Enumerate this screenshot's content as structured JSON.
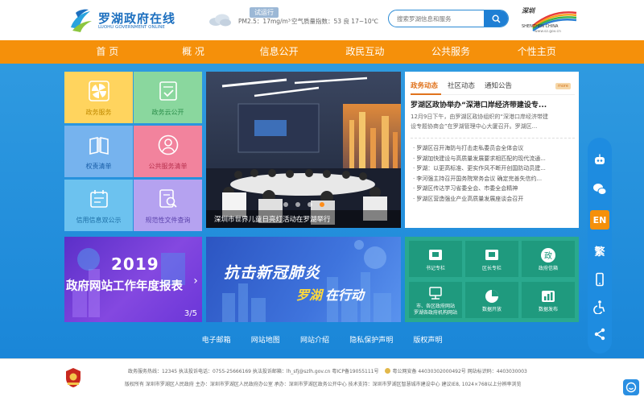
{
  "header": {
    "site_title": "罗湖政府在线",
    "site_subtitle": "LUOHU GOVERNMENT ONLINE",
    "trial_badge": "试运行",
    "weather": {
      "pm25": "PM2.5：17mg/m³",
      "aqi": "空气质量指数：53 良  17~10℃"
    },
    "search_placeholder": "搜索罗湖信息和服务",
    "shenzhen_logo": {
      "title": "深圳",
      "subtitle": "SHENZHEN CHINA",
      "url": "www.sz.gov.cn"
    }
  },
  "nav": {
    "items": [
      {
        "label": "首 页"
      },
      {
        "label": "概 况"
      },
      {
        "label": "信息公开"
      },
      {
        "label": "政民互动"
      },
      {
        "label": "公共服务"
      },
      {
        "label": "个性主页"
      }
    ]
  },
  "tiles": [
    {
      "label": "政务服务",
      "icon": "pinwheel-icon"
    },
    {
      "label": "政务云公开",
      "icon": "document-check-icon"
    },
    {
      "label": "权责清单",
      "icon": "book-icon"
    },
    {
      "label": "公共服务清单",
      "icon": "user-icon"
    },
    {
      "label": "信用信息双公示",
      "icon": "calendar-list-icon"
    },
    {
      "label": "规范性文件查询",
      "icon": "document-search-icon"
    }
  ],
  "carousel": {
    "caption": "深圳市世界儿童日亮灯活动在罗湖举行",
    "dot_count": 4,
    "active_dot": 4
  },
  "news": {
    "tabs": [
      {
        "label": "政务动态",
        "active": true
      },
      {
        "label": "社区动态",
        "active": false
      },
      {
        "label": "通知公告",
        "active": false
      }
    ],
    "more_label": "more",
    "headline": "罗湖区政协举办“深港口岸经济带建设专...",
    "summary_lines": [
      "12月9日下午，由罗湖区政协组织的“深港口岸经济带建",
      "设专题协商会”在罗湖管理中心大厦召开。罗湖区..."
    ],
    "items": [
      "罗湖区召开海防与打击走私委员会全体会议",
      "罗湖加快建设与高质量发展要求相匹配的现代流通...",
      "罗湖：以更高标准、更实作风不断开创国防动员建...",
      "李河强主持召开国务院常务会议 确定完善失信约...",
      "罗湖区传达学习省委全会、市委全会精神",
      "罗湖区营造强业产业高质量发展座谈会召开"
    ]
  },
  "banner_2019": {
    "year": "2019",
    "title": "政府网站工作年度报表",
    "counter": "3/5"
  },
  "banner_covid": {
    "title": "抗击新冠肺炎",
    "sub_highlight": "罗湖",
    "sub_rest": "在行动"
  },
  "grid_panel": {
    "items": [
      {
        "label": "书记专栏",
        "icon": "flag-icon"
      },
      {
        "label": "区长专栏",
        "icon": "flag-icon"
      },
      {
        "label": "政府信箱",
        "icon": "government-icon"
      },
      {
        "label": "市、各区政府网站\n罗湖各政府机构网站",
        "icon": "network-icon"
      },
      {
        "label": "数据开放",
        "icon": "pie-chart-icon"
      },
      {
        "label": "数据发布",
        "icon": "bar-chart-icon"
      }
    ]
  },
  "side_tools": [
    {
      "name": "robot-icon"
    },
    {
      "name": "wechat-icon"
    },
    {
      "name": "english-icon",
      "text": "EN"
    },
    {
      "name": "traditional-chinese-icon",
      "text": "繁"
    },
    {
      "name": "mobile-icon"
    },
    {
      "name": "accessibility-icon"
    },
    {
      "name": "share-icon"
    }
  ],
  "footer_links": [
    "电子邮箱",
    "网站地图",
    "网站介绍",
    "隐私保护声明",
    "版权声明"
  ],
  "footer": {
    "line1": "政务服务热线：12345  执法投诉电话：0755-25666169  执法投诉邮箱：lh_sfj@szlh.gov.cn  粤ICP备19055111号",
    "line1_police": "粤公网安备 44030302000492号  网站标识码：4403030003",
    "line2": "版权所有 深圳市罗湖区人民政府  主办：深圳市罗湖区人民政府办公室  承办：深圳市罗湖区政务公开中心  技术支持：深圳市罗湖区智慧城市建设中心  建议IE8, 1024×768以上分辨率浏览"
  },
  "colors": {
    "nav_orange": "#f5900a",
    "main_blue": "#1a86d8",
    "accent_orange": "#e0731d",
    "panel_green": "#2aa98e"
  }
}
